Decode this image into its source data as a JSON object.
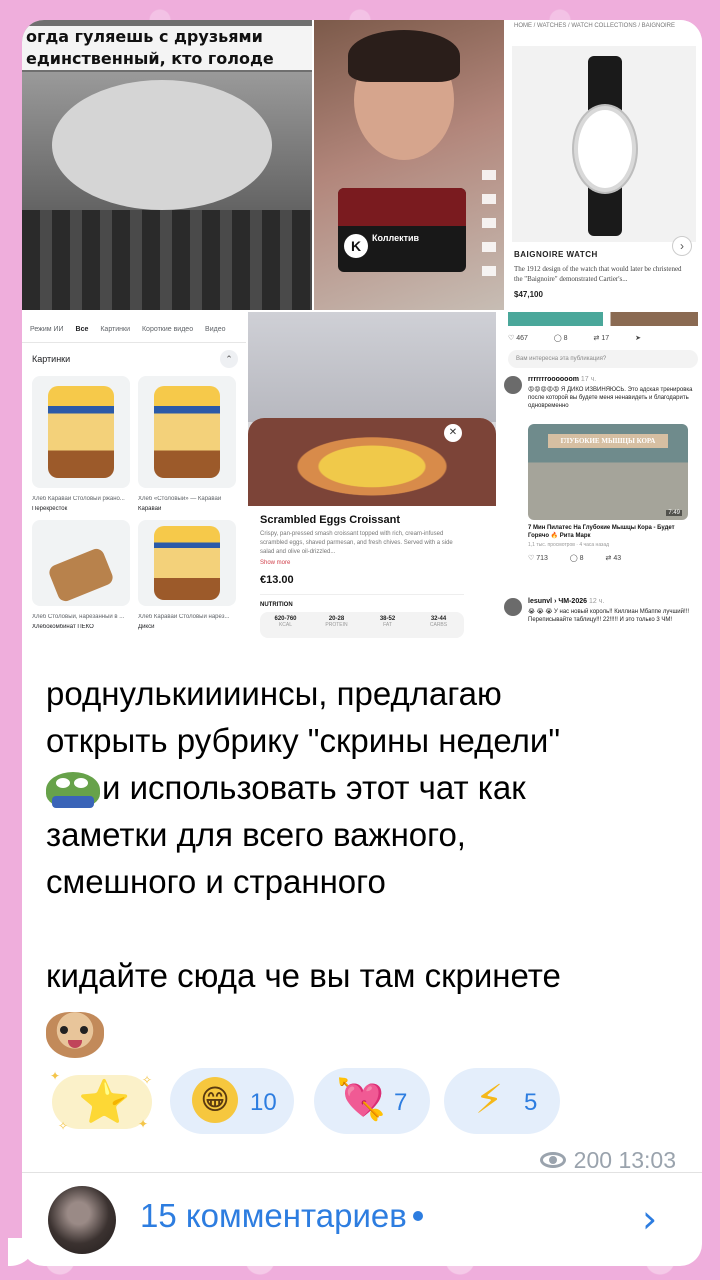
{
  "collage": {
    "pig_meme": {
      "caption_line1": "огда гуляешь с друзьями",
      "caption_line2": "единственный, кто голоде"
    },
    "tiktok": {
      "card_title": "Коллектив",
      "logo_letter": "K"
    },
    "watch": {
      "breadcrumb": "HOME / WATCHES / WATCH COLLECTIONS / BAIGNOIRE",
      "name": "BAIGNOIRE WATCH",
      "description": "The 1912 design of the watch that would later be christened the \"Baignoire\" demonstrated Cartier's...",
      "price": "$47,100",
      "next_icon": "chevron-right-icon"
    },
    "google": {
      "tabs": [
        "Режим ИИ",
        "Все",
        "Картинки",
        "Короткие видео",
        "Видео"
      ],
      "active_tab": "Все",
      "section_title": "Картинки",
      "items": [
        {
          "caption": "Хлеб Каравай Столовый ржано...",
          "store": "Перекрёсток"
        },
        {
          "caption": "Хлеб «Столовый» — Каравай",
          "store": "Каравай"
        },
        {
          "caption": "Хлеб Столовый, нарезанный в ...",
          "store": "Хлебокомбинат ПЕКО"
        },
        {
          "caption": "Хлеб Каравай Столовый нарез...",
          "store": "Дикси"
        }
      ]
    },
    "eggs": {
      "title": "Scrambled Eggs Croissant",
      "description": "Crispy, pan-pressed smash croissant topped with rich, cream-infused scrambled eggs, shaved parmesan, and fresh chives. Served with a side salad and olive oil-drizzled...",
      "show_more": "Show more",
      "price": "€13.00",
      "nutrition_title": "NUTRITION",
      "nutrition": [
        {
          "value": "620-760",
          "label": "KCAL"
        },
        {
          "value": "20-28",
          "label": "PROTEIN"
        },
        {
          "value": "38-52",
          "label": "FAT"
        },
        {
          "value": "32-44",
          "label": "CARBS"
        }
      ]
    },
    "threads": {
      "stats_top": {
        "likes": "467",
        "comments": "8",
        "reposts": "17"
      },
      "question": "Вам интересна эта публикация?",
      "post1": {
        "user": "rrrrrrroooooom",
        "time": "17 ч.",
        "text": "😡😡😡😡😡 Я ДИКО ИЗВИНЯЮСЬ. Это адская тренировка после которой вы будете меня ненавидеть и благодарить одновременно",
        "video_title": "ГЛУБОКИЕ МЫШЦЫ КОРА",
        "video_duration": "7:49",
        "video_caption": "7 Мин Пилатес На Глубокие Мышцы Кора - Будет Горячо 🔥 Рита Марк",
        "video_sub": "1,1 тыс. просмотров · 4 часа назад",
        "stats": {
          "likes": "713",
          "comments": "8",
          "reposts": "43"
        }
      },
      "post2": {
        "user": "lesunvl › ЧМ-2026",
        "time": "12 ч.",
        "text": "😭 😭 😭 У нас новый король!! Киллиан Мбаппе лучший!!! Переписывайте таблицу!!! 22!!!!! И это только 3 ЧМ!"
      }
    }
  },
  "message": {
    "line1": "роднулькиииинсы, предлагаю",
    "line2": "открыть рубрику \"скрины недели\"",
    "line3": "и использовать этот чат как",
    "line4": "заметки для всего важного,",
    "line5": "смешного и странного",
    "line6": "кидайте сюда че вы там скринете"
  },
  "reactions": [
    {
      "emoji": "⭐",
      "icon": "star-icon"
    },
    {
      "emoji": "😁",
      "icon": "grin-icon",
      "count": "10"
    },
    {
      "emoji": "💘",
      "icon": "heart-arrow-icon",
      "count": "7"
    },
    {
      "emoji": "⚡",
      "icon": "lightning-icon",
      "count": "5"
    }
  ],
  "meta": {
    "views": "200",
    "time": "13:03"
  },
  "comments": {
    "label": "15 комментариев",
    "chevron": "›"
  },
  "colors": {
    "background": "#efaedc",
    "accent": "#2d7de0",
    "meta_gray": "#9aa3ad",
    "reaction_pill": "#e4eefb"
  }
}
